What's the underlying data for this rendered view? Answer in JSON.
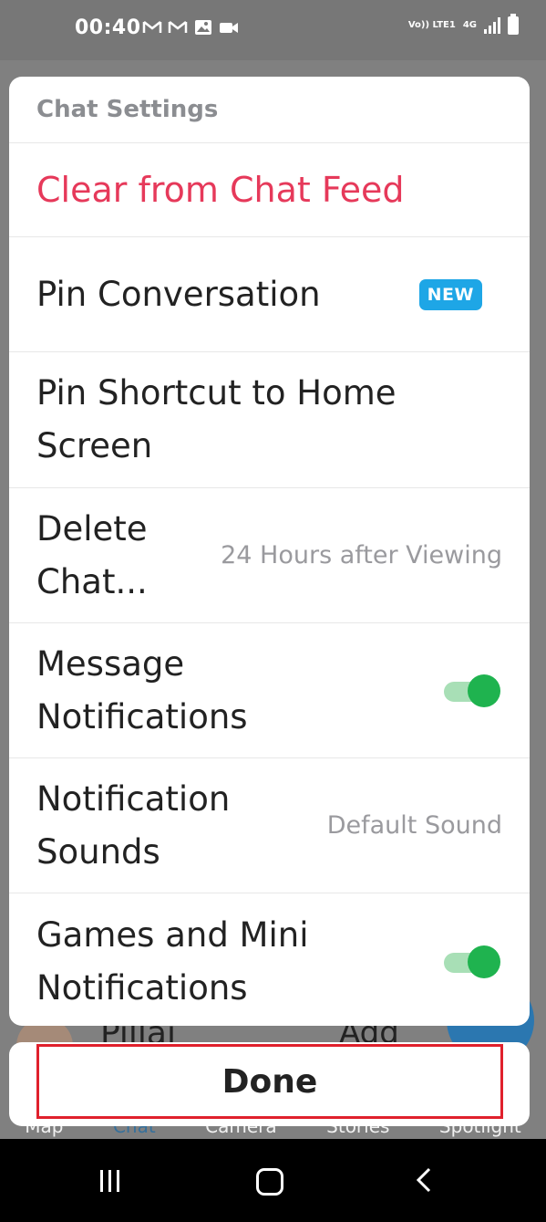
{
  "status_bar": {
    "time": "00:40",
    "volte": "Vo)) LTE1",
    "network": "4G",
    "icons": [
      "gmail-icon",
      "gmail-icon",
      "gallery-icon",
      "video-icon",
      "signal-icon",
      "battery-icon"
    ]
  },
  "sheet": {
    "title": "Chat Settings",
    "clear_label": "Clear from Chat Feed",
    "pin_conversation": {
      "label": "Pin Conversation",
      "badge": "NEW"
    },
    "pin_shortcut": {
      "label_line1": "Pin Shortcut to Home",
      "label_line2": "Screen"
    },
    "delete_chat": {
      "label_line1": "Delete",
      "label_line2": "Chat...",
      "value": "24 Hours after Viewing"
    },
    "message_notifications": {
      "label_line1": "Message",
      "label_line2": "Notifications",
      "enabled": true
    },
    "notification_sounds": {
      "label_line1": "Notification",
      "label_line2": "Sounds",
      "value": "Default Sound"
    },
    "games_notifications": {
      "label_line1": "Games and Mini",
      "label_line2": "Notifications",
      "enabled": true
    }
  },
  "done_label": "Done",
  "background": {
    "name_fragment": "Pillai",
    "add_label": "Add",
    "nav": [
      "Map",
      "Chat",
      "Camera",
      "Stories",
      "Spotlight"
    ]
  },
  "colors": {
    "accent_red": "#e6395a",
    "badge_blue": "#1ea6e6",
    "toggle_green": "#1fb34f",
    "highlight_border": "#e0202c"
  }
}
